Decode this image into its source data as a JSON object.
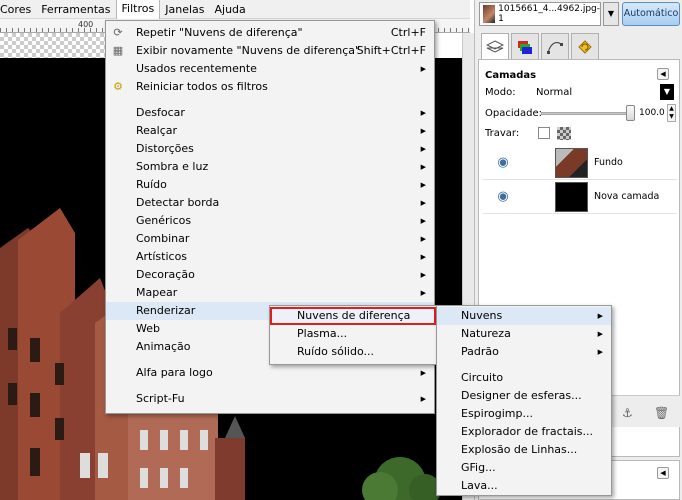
{
  "menubar": {
    "items": [
      "Cores",
      "Ferramentas",
      "Filtros",
      "Janelas",
      "Ajuda"
    ]
  },
  "ruler": {
    "label": "400"
  },
  "filters_menu": {
    "items": [
      {
        "label": "Repetir \"Nuvens de diferença\"",
        "shortcut": "Ctrl+F",
        "icon": "repeat-icon"
      },
      {
        "label": "Exibir novamente \"Nuvens de diferença\"",
        "shortcut": "Shift+Ctrl+F",
        "icon": "reshow-icon"
      },
      {
        "label": "Usados recentemente",
        "submenu": true
      },
      {
        "label": "Reiniciar todos os filtros",
        "icon": "reset-icon"
      },
      {
        "separator": true
      },
      {
        "label": "Desfocar",
        "submenu": true
      },
      {
        "label": "Realçar",
        "submenu": true
      },
      {
        "label": "Distorções",
        "submenu": true
      },
      {
        "label": "Sombra e luz",
        "submenu": true
      },
      {
        "label": "Ruído",
        "submenu": true
      },
      {
        "label": "Detectar borda",
        "submenu": true
      },
      {
        "label": "Genéricos",
        "submenu": true
      },
      {
        "label": "Combinar",
        "submenu": true
      },
      {
        "label": "Artísticos",
        "submenu": true
      },
      {
        "label": "Decoração",
        "submenu": true
      },
      {
        "label": "Mapear",
        "submenu": true
      },
      {
        "label": "Renderizar",
        "submenu": true,
        "highlighted": true
      },
      {
        "label": "Web",
        "submenu": true
      },
      {
        "label": "Animação",
        "submenu": true
      },
      {
        "separator": true
      },
      {
        "label": "Alfa para logo",
        "submenu": true
      },
      {
        "separator": true
      },
      {
        "label": "Script-Fu",
        "submenu": true
      }
    ]
  },
  "render_menu": {
    "items": [
      {
        "label": "Nuvens de diferença",
        "boxed": true
      },
      {
        "label": "Plasma..."
      },
      {
        "label": "Ruído sólido..."
      }
    ]
  },
  "nuvens_menu": {
    "items": [
      {
        "label": "Nuvens",
        "submenu": true,
        "highlighted": true
      },
      {
        "label": "Natureza",
        "submenu": true
      },
      {
        "label": "Padrão",
        "submenu": true
      },
      {
        "separator": true
      },
      {
        "label": "Circuito"
      },
      {
        "label": "Designer de esferas..."
      },
      {
        "label": "Espirogimp..."
      },
      {
        "label": "Explorador de fractais..."
      },
      {
        "label": "Explosão de Linhas..."
      },
      {
        "label": "GFig..."
      },
      {
        "label": "Lava..."
      }
    ]
  },
  "dock": {
    "image_name": "1015661_4...4962.jpg-1",
    "auto_button": "Automático",
    "layers_title": "Camadas",
    "mode_label": "Modo:",
    "mode_value": "Normal",
    "opacity_label": "Opacidade:",
    "opacity_value": "100.0",
    "opacity": 1.0,
    "lock_label": "Travar:",
    "layers": [
      {
        "name": "Fundo",
        "visible": true
      },
      {
        "name": "Nova camada",
        "visible": true
      }
    ]
  },
  "colors": {
    "menu_bg": "#f3f3f3",
    "highlight": "#dce8f6",
    "red_outline": "#e01e1e",
    "auto_button": "#a9cdf2"
  }
}
